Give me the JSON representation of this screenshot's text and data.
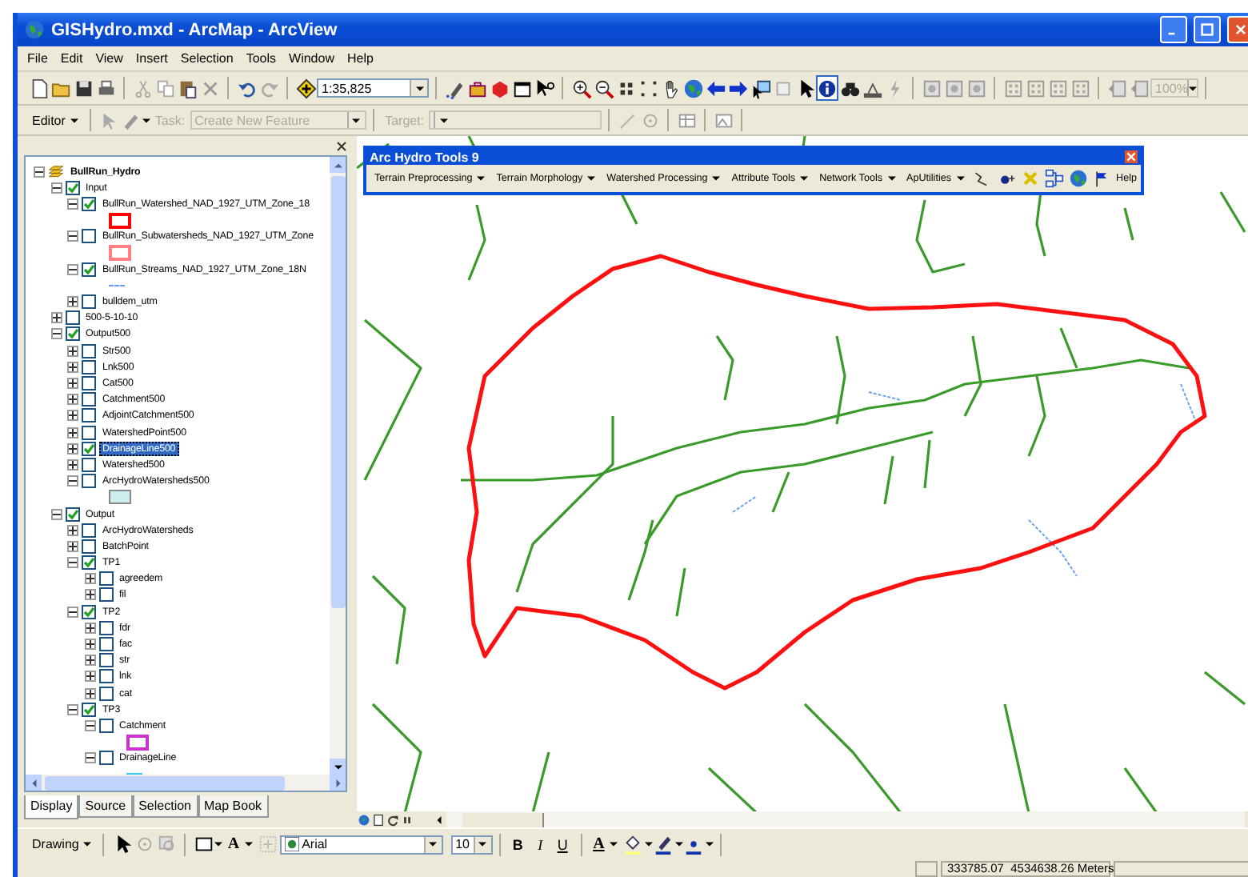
{
  "window": {
    "title": "GISHydro.mxd - ArcMap - ArcView"
  },
  "menu_bar": [
    "File",
    "Edit",
    "View",
    "Insert",
    "Selection",
    "Tools",
    "Window",
    "Help"
  ],
  "standard_toolbar": {
    "scale": "1:35,825",
    "zoom": "100%"
  },
  "editor_toolbar": {
    "menu": "Editor",
    "task_label": "Task:",
    "task": "Create New Feature",
    "target_label": "Target:",
    "disabled": true
  },
  "toc": {
    "tree": [
      {
        "label": "BullRun_Hydro",
        "expanded": true,
        "selected": false,
        "children": [
          {
            "label": "Input",
            "checked": true,
            "expanded": true,
            "selected": false,
            "children": [
              {
                "label": "BullRun_Watershed_NAD_1927_UTM_Zone_18",
                "checked": true,
                "expanded": true,
                "selected": false,
                "symbol": {
                  "kind": "outline",
                  "color": "#ff0000"
                }
              },
              {
                "label": "BullRun_Subwatersheds_NAD_1927_UTM_Zone",
                "checked": false,
                "expanded": true,
                "selected": false,
                "symbol": {
                  "kind": "outline",
                  "color": "#ff8080"
                }
              },
              {
                "label": "BullRun_Streams_NAD_1927_UTM_Zone_18N",
                "checked": true,
                "expanded": true,
                "selected": false,
                "symbol": {
                  "kind": "dashed",
                  "color": "#6699ff"
                }
              },
              {
                "label": "bulldem_utm",
                "checked": false,
                "expanded": false,
                "selected": false
              }
            ]
          },
          {
            "label": "500-5-10-10",
            "checked": false,
            "expanded": false,
            "selected": false
          },
          {
            "label": "Output500",
            "checked": true,
            "expanded": true,
            "selected": false,
            "children": [
              {
                "label": "Str500",
                "checked": false,
                "expanded": false,
                "selected": false
              },
              {
                "label": "Lnk500",
                "checked": false,
                "expanded": false,
                "selected": false
              },
              {
                "label": "Cat500",
                "checked": false,
                "expanded": false,
                "selected": false
              },
              {
                "label": "Catchment500",
                "checked": false,
                "expanded": false,
                "selected": false
              },
              {
                "label": "AdjointCatchment500",
                "checked": false,
                "expanded": false,
                "selected": false
              },
              {
                "label": "WatershedPoint500",
                "checked": false,
                "expanded": false,
                "selected": false
              },
              {
                "label": "DrainageLine500",
                "checked": true,
                "expanded": false,
                "selected": true
              },
              {
                "label": "Watershed500",
                "checked": false,
                "expanded": false,
                "selected": false
              },
              {
                "label": "ArcHydroWatersheds500",
                "checked": false,
                "expanded": true,
                "selected": false,
                "symbol": {
                  "kind": "fill",
                  "color": "#cdeeee"
                }
              }
            ]
          },
          {
            "label": "Output",
            "checked": true,
            "expanded": true,
            "selected": false,
            "children": [
              {
                "label": "ArcHydroWatersheds",
                "checked": false,
                "expanded": false,
                "selected": false
              },
              {
                "label": "BatchPoint",
                "checked": false,
                "expanded": false,
                "selected": false
              },
              {
                "label": "TP1",
                "checked": true,
                "expanded": true,
                "selected": false,
                "children": [
                  {
                    "label": "agreedem",
                    "checked": false,
                    "expanded": false,
                    "selected": false
                  },
                  {
                    "label": "fil",
                    "checked": false,
                    "expanded": false,
                    "selected": false
                  }
                ]
              },
              {
                "label": "TP2",
                "checked": true,
                "expanded": true,
                "selected": false,
                "children": [
                  {
                    "label": "fdr",
                    "checked": false,
                    "expanded": false,
                    "selected": false
                  },
                  {
                    "label": "fac",
                    "checked": false,
                    "expanded": false,
                    "selected": false
                  },
                  {
                    "label": "str",
                    "checked": false,
                    "expanded": false,
                    "selected": false
                  },
                  {
                    "label": "lnk",
                    "checked": false,
                    "expanded": false,
                    "selected": false
                  },
                  {
                    "label": "cat",
                    "checked": false,
                    "expanded": false,
                    "selected": false
                  }
                ]
              },
              {
                "label": "TP3",
                "checked": true,
                "expanded": true,
                "selected": false,
                "children": [
                  {
                    "label": "Catchment",
                    "checked": false,
                    "expanded": true,
                    "selected": false,
                    "symbol": {
                      "kind": "outline",
                      "color": "#cc33cc"
                    }
                  },
                  {
                    "label": "DrainageLine",
                    "checked": false,
                    "expanded": true,
                    "selected": false,
                    "symbol": {
                      "kind": "line",
                      "color": "#33ccee"
                    }
                  }
                ]
              }
            ]
          }
        ]
      }
    ],
    "tabs": [
      {
        "label": "Display",
        "selected": true
      },
      {
        "label": "Source",
        "selected": false
      },
      {
        "label": "Selection",
        "selected": false
      },
      {
        "label": "Map Book",
        "selected": false
      }
    ]
  },
  "arc_hydro_toolbar": {
    "title": "Arc Hydro Tools 9",
    "menus": [
      "Terrain Preprocessing",
      "Terrain Morphology",
      "Watershed Processing",
      "Attribute Tools",
      "Network Tools",
      "ApUtilities"
    ],
    "help": "Help"
  },
  "drawing_toolbar": {
    "menu": "Drawing",
    "text_tool": "A",
    "font": "Arial",
    "font_size": "10",
    "styles": [
      "B",
      "I",
      "U"
    ],
    "font_color": "A"
  },
  "status_bar": {
    "coordinates": "333785.07  4534638.26 Meters"
  }
}
